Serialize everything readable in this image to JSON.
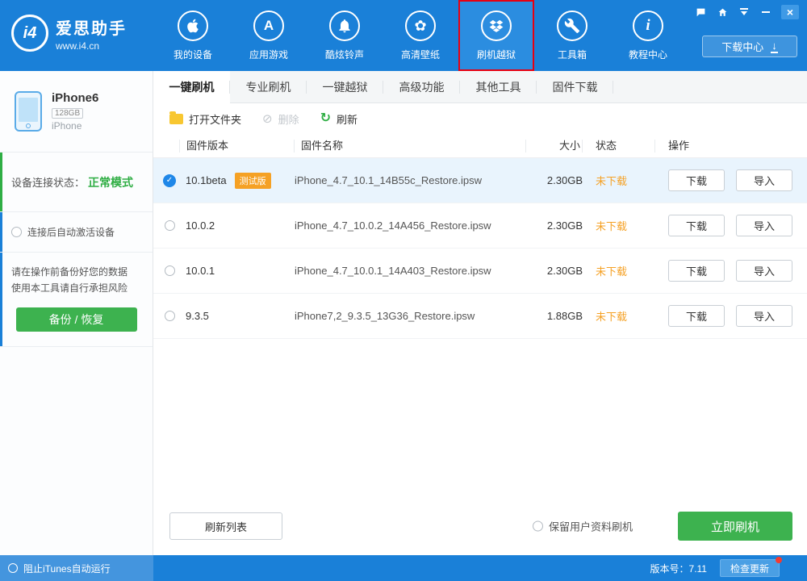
{
  "header": {
    "logo_title": "爱思助手",
    "logo_subtitle": "www.i4.cn",
    "nav": [
      {
        "label": "我的设备"
      },
      {
        "label": "应用游戏"
      },
      {
        "label": "酷炫铃声"
      },
      {
        "label": "高清壁纸"
      },
      {
        "label": "刷机越狱",
        "highlighted": true
      },
      {
        "label": "工具箱"
      },
      {
        "label": "教程中心"
      }
    ],
    "download_center": "下载中心"
  },
  "sidebar": {
    "device": {
      "name": "iPhone6",
      "capacity": "128GB",
      "type": "iPhone"
    },
    "status_label": "设备连接状态：",
    "status_value": "正常模式",
    "auto_activate": "连接后自动激活设备",
    "warning_line1": "请在操作前备份好您的数据",
    "warning_line2": "使用本工具请自行承担风险",
    "backup_button": "备份 / 恢复"
  },
  "tabs": [
    {
      "label": "一键刷机",
      "active": true
    },
    {
      "label": "专业刷机"
    },
    {
      "label": "一键越狱"
    },
    {
      "label": "高级功能"
    },
    {
      "label": "其他工具"
    },
    {
      "label": "固件下载"
    }
  ],
  "toolbar": {
    "open_folder": "打开文件夹",
    "delete": "删除",
    "refresh": "刷新"
  },
  "table": {
    "headers": {
      "version": "固件版本",
      "name": "固件名称",
      "size": "大小",
      "status": "状态",
      "action": "操作"
    },
    "rows": [
      {
        "selected": true,
        "version": "10.1beta",
        "badge": "测试版",
        "name": "iPhone_4.7_10.1_14B55c_Restore.ipsw",
        "size": "2.30GB",
        "status": "未下载",
        "download": "下载",
        "import": "导入"
      },
      {
        "selected": false,
        "version": "10.0.2",
        "name": "iPhone_4.7_10.0.2_14A456_Restore.ipsw",
        "size": "2.30GB",
        "status": "未下载",
        "download": "下载",
        "import": "导入"
      },
      {
        "selected": false,
        "version": "10.0.1",
        "name": "iPhone_4.7_10.0.1_14A403_Restore.ipsw",
        "size": "2.30GB",
        "status": "未下载",
        "download": "下载",
        "import": "导入"
      },
      {
        "selected": false,
        "version": "9.3.5",
        "name": "iPhone7,2_9.3.5_13G36_Restore.ipsw",
        "size": "1.88GB",
        "status": "未下载",
        "download": "下载",
        "import": "导入"
      }
    ]
  },
  "footer_panel": {
    "refresh_list": "刷新列表",
    "keep_data": "保留用户资料刷机",
    "flash_now": "立即刷机"
  },
  "statusbar": {
    "block_itunes": "阻止iTunes自动运行",
    "version": "版本号：7.11",
    "check_update": "检查更新"
  },
  "icons": {
    "logo": "i4",
    "appstore_letter": "A",
    "info_letter": "i",
    "flower": "✿",
    "check": "✓",
    "down_arrow": "↓",
    "refresh": "↻",
    "delete": "⊘",
    "close": "×"
  },
  "colors": {
    "header_blue": "#1a80d8",
    "highlight_red": "#e60012",
    "green": "#3db24f",
    "status_green": "#2fae44",
    "orange": "#f5a125",
    "selected_row": "#e9f4fd"
  }
}
